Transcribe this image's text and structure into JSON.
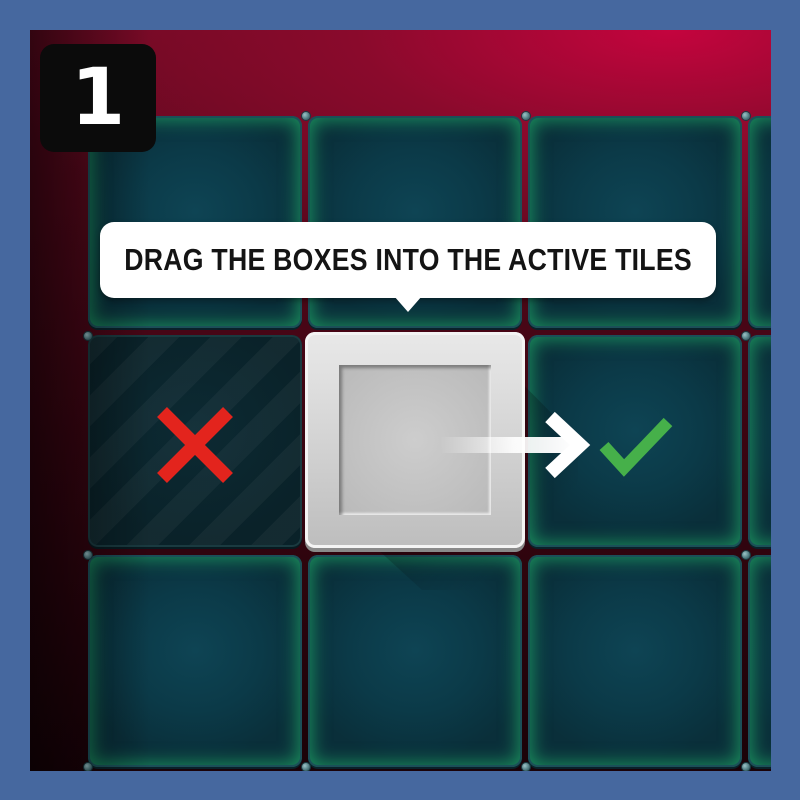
{
  "step": {
    "number": "1"
  },
  "tutorial": {
    "instruction": "DRAG THE BOXES INTO THE ACTIVE TILES"
  },
  "grid": {
    "rows": 3,
    "columns": 4,
    "inactive_tile": "row-2-col-1",
    "active_tile": "row-2-col-3",
    "box_position": "row-2-col-2"
  },
  "icons": {
    "wrong": "x-icon",
    "correct": "check-icon",
    "direction": "arrow-right-icon"
  },
  "colors": {
    "background": "#46689f",
    "tile_glow": "#28dc78",
    "x_mark": "#e3241d",
    "check_mark": "#46b04a",
    "bubble": "#ffffff",
    "badge": "#0b0b0b"
  }
}
